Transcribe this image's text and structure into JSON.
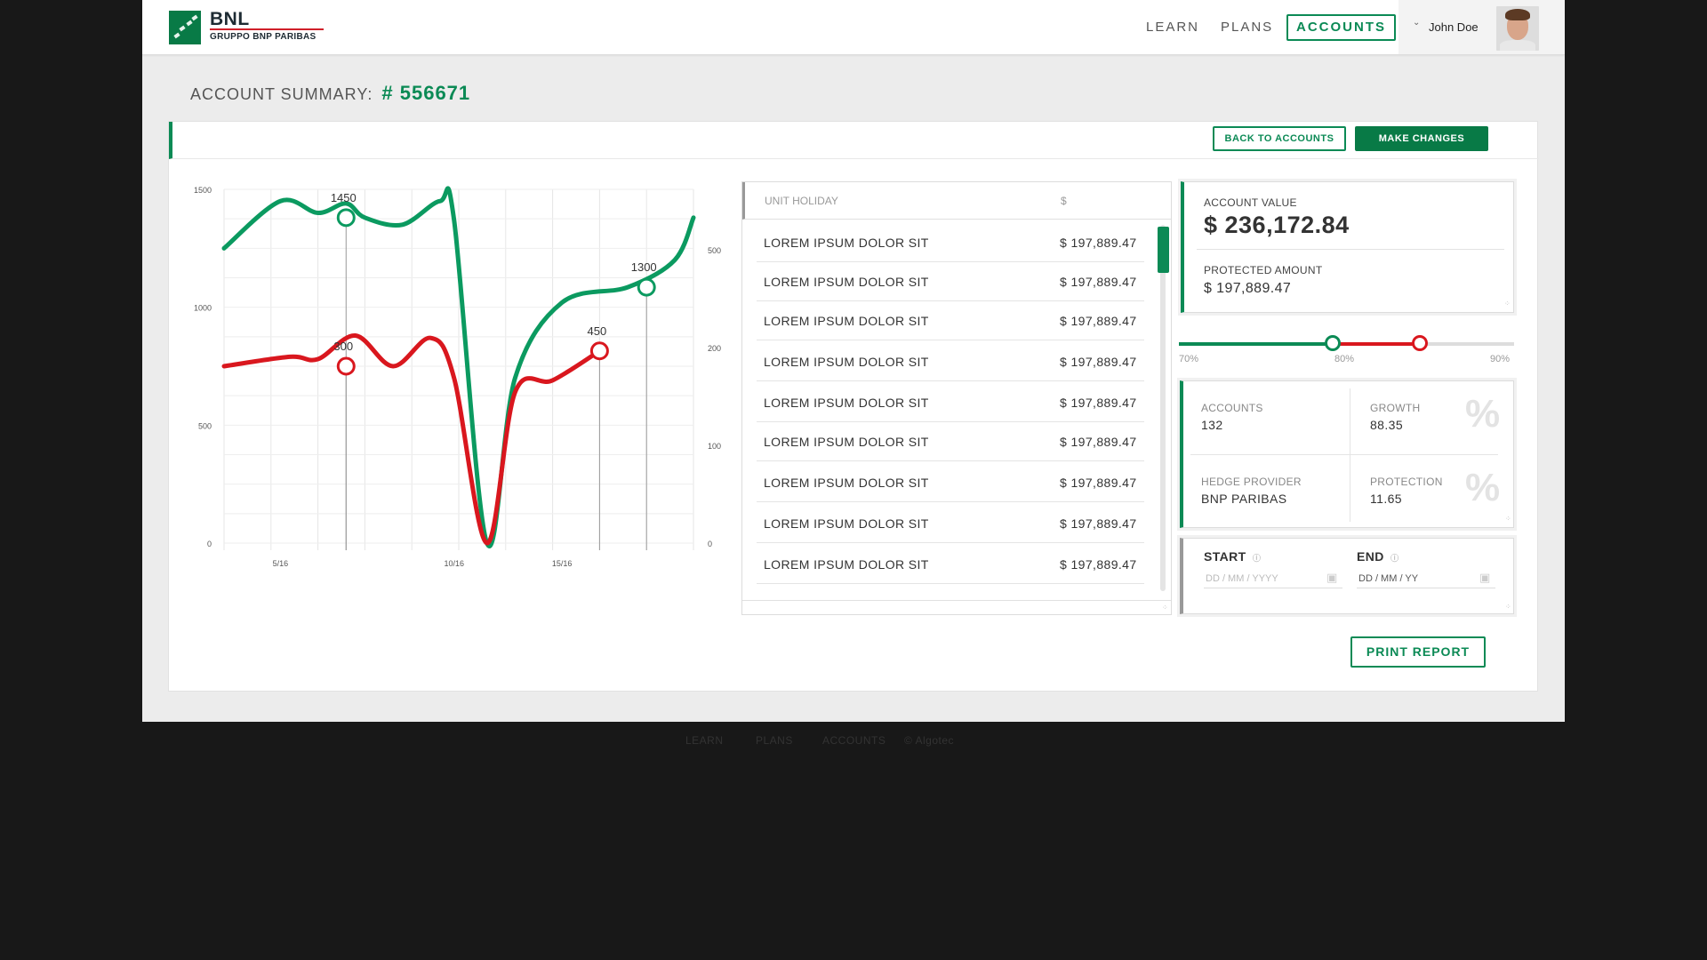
{
  "brand": {
    "name": "BNL",
    "subtitle": "GRUPPO BNP PARIBAS"
  },
  "nav": {
    "learn": "LEARN",
    "plans": "PLANS",
    "accounts": "ACCOUNTS"
  },
  "user": {
    "name": "John Doe"
  },
  "summary": {
    "label": "ACCOUNT SUMMARY:",
    "account_number": "# 556671"
  },
  "actions": {
    "back": "BACK TO ACCOUNTS",
    "make_changes": "MAKE CHANGES",
    "print": "PRINT REPORT"
  },
  "chart_data": {
    "type": "line",
    "x_ticks": [
      "5/16",
      "10/16",
      "15/16"
    ],
    "y_left_ticks": [
      "1500",
      "1000",
      "500",
      "0"
    ],
    "y_right_ticks": [
      "500",
      "200",
      "100",
      "0"
    ],
    "series": [
      {
        "color": "#0b9a60",
        "x": [
          0,
          0.12,
          0.2,
          0.26,
          0.3,
          0.38,
          0.46,
          0.49,
          0.56,
          0.62,
          0.72,
          0.86,
          0.96,
          1.0
        ],
        "y": [
          1250,
          1450,
          1400,
          1440,
          1380,
          1350,
          1450,
          1370,
          0,
          700,
          1020,
          1085,
          1200,
          1380
        ]
      },
      {
        "color": "#d9171e",
        "x": [
          0,
          0.14,
          0.2,
          0.28,
          0.36,
          0.44,
          0.49,
          0.56,
          0.62,
          0.7,
          0.8
        ],
        "y": [
          750,
          790,
          780,
          880,
          750,
          870,
          700,
          0,
          640,
          690,
          815
        ]
      }
    ],
    "annotations": [
      {
        "text": "1450",
        "series": 0,
        "x": 0.26,
        "y": 1380
      },
      {
        "text": "300",
        "series": 1,
        "x": 0.26,
        "y": 750
      },
      {
        "text": "450",
        "series": 1,
        "x": 0.8,
        "y": 815
      },
      {
        "text": "1300",
        "series": 0,
        "x": 0.9,
        "y": 1085
      }
    ],
    "ylim": [
      0,
      1500
    ]
  },
  "table": {
    "headers": [
      "UNIT HOLIDAY",
      "$"
    ],
    "rows": [
      [
        "LOREM IPSUM DOLOR SIT",
        "$ 197,889.47"
      ],
      [
        "LOREM IPSUM DOLOR SIT",
        "$ 197,889.47"
      ],
      [
        "LOREM IPSUM DOLOR SIT",
        "$ 197,889.47"
      ],
      [
        "LOREM IPSUM DOLOR SIT",
        "$ 197,889.47"
      ],
      [
        "LOREM IPSUM DOLOR SIT",
        "$ 197,889.47"
      ],
      [
        "LOREM IPSUM DOLOR SIT",
        "$ 197,889.47"
      ],
      [
        "LOREM IPSUM DOLOR SIT",
        "$ 197,889.47"
      ],
      [
        "LOREM IPSUM DOLOR SIT",
        "$ 197,889.47"
      ],
      [
        "LOREM IPSUM DOLOR SIT",
        "$ 197,889.47"
      ]
    ]
  },
  "account_value": {
    "label": "ACCOUNT VALUE",
    "value": "$ 236,172.84",
    "protected_label": "PROTECTED AMOUNT",
    "protected_value": "$ 197,889.47"
  },
  "slider": {
    "min_label": "70%",
    "mid_label": "80%",
    "max_label": "90%",
    "low_value": 0.46,
    "high_value": 0.72,
    "green": "#0b8a55",
    "red": "#d9171e"
  },
  "stats": {
    "accounts_label": "ACCOUNTS",
    "accounts_value": "132",
    "growth_label": "GROWTH",
    "growth_value": "88.35",
    "hedge_label": "HEDGE PROVIDER",
    "hedge_value": "BNP PARIBAS",
    "protection_label": "PROTECTION",
    "protection_value": "11.65",
    "percent_symbol": "%"
  },
  "dates": {
    "start_label": "START",
    "end_label": "END",
    "start_placeholder": "DD / MM / YYYY",
    "end_value": "DD / MM / YY"
  },
  "footer": {
    "learn": "LEARN",
    "plans": "PLANS",
    "accounts": "ACCOUNTS",
    "copyright": "© Algotec"
  }
}
